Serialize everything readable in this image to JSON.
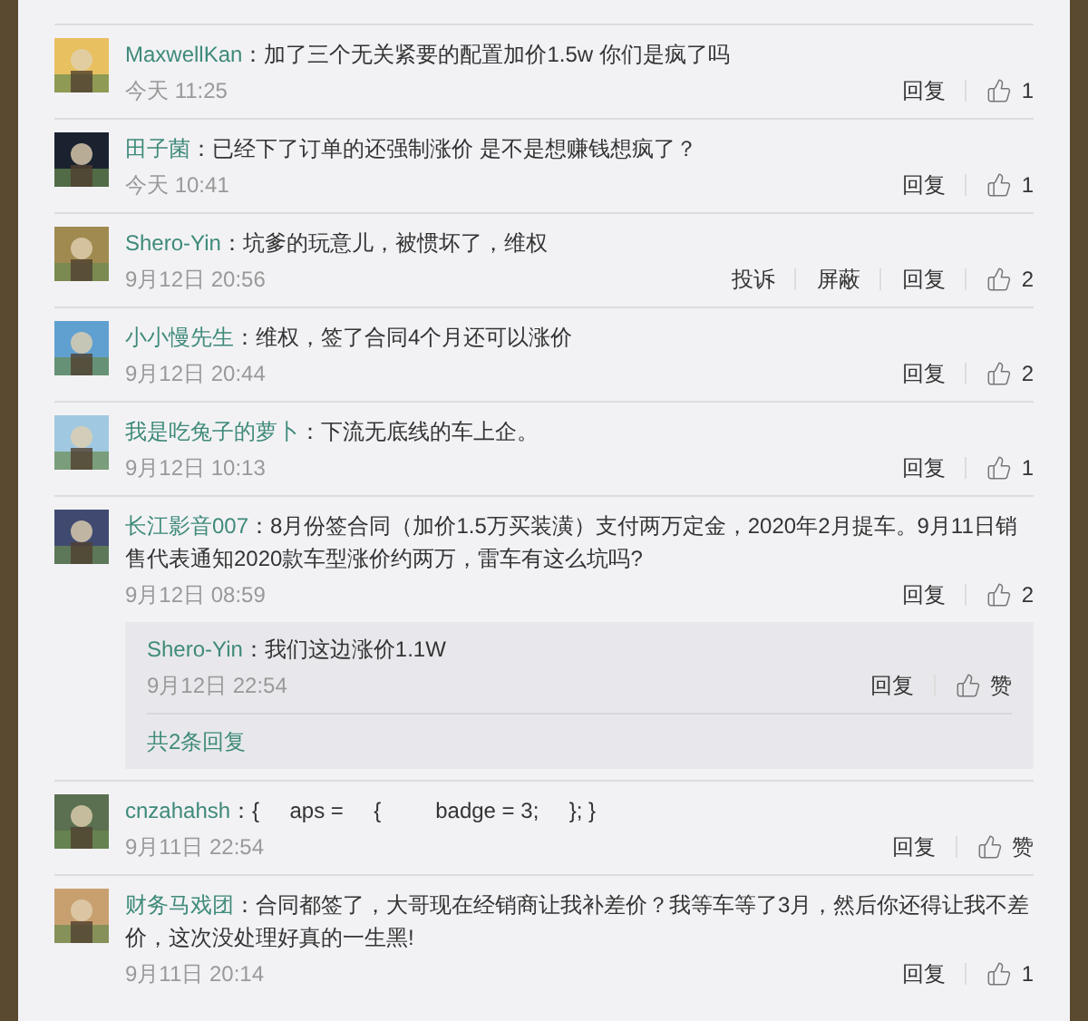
{
  "comments": [
    {
      "user": "MaxwellKan",
      "text": "：加了三个无关紧要的配置加价1.5w 你们是疯了吗",
      "time": "今天 11:25",
      "actions": [
        "回复"
      ],
      "likes": "1"
    },
    {
      "user": "田子菌",
      "text": "：已经下了订单的还强制涨价 是不是想赚钱想疯了？",
      "time": "今天 10:41",
      "actions": [
        "回复"
      ],
      "likes": "1"
    },
    {
      "user": "Shero-Yin",
      "text": "：坑爹的玩意儿，被惯坏了，维权",
      "time": "9月12日 20:56",
      "actions": [
        "投诉",
        "屏蔽",
        "回复"
      ],
      "likes": "2"
    },
    {
      "user": "小小慢先生",
      "text": "：维权，签了合同4个月还可以涨价",
      "time": "9月12日 20:44",
      "actions": [
        "回复"
      ],
      "likes": "2"
    },
    {
      "user": "我是吃兔子的萝卜",
      "text": "：下流无底线的车上企。",
      "time": "9月12日 10:13",
      "actions": [
        "回复"
      ],
      "likes": "1"
    },
    {
      "user": "长江影音007",
      "text": "：8月份签合同（加价1.5万买装潢）支付两万定金，2020年2月提车。9月11日销售代表通知2020款车型涨价约两万，雷车有这么坑吗?",
      "time": "9月12日 08:59",
      "actions": [
        "回复"
      ],
      "likes": "2",
      "replies": {
        "items": [
          {
            "user": "Shero-Yin",
            "text": "：我们这边涨价1.1W",
            "time": "9月12日 22:54",
            "actions": [
              "回复"
            ],
            "likes": "赞"
          }
        ],
        "more": "共2条回复"
      }
    },
    {
      "user": "cnzahahsh",
      "text": "：{     aps =     {         badge = 3;     }; }",
      "time": "9月11日 22:54",
      "actions": [
        "回复"
      ],
      "likes": "赞"
    },
    {
      "user": "财务马戏团",
      "text": "：合同都签了，大哥现在经销商让我补差价？我等车等了3月，然后你还得让我不差价，这次没处理好真的一生黑!",
      "time": "9月11日 20:14",
      "actions": [
        "回复"
      ],
      "likes": "1"
    }
  ]
}
